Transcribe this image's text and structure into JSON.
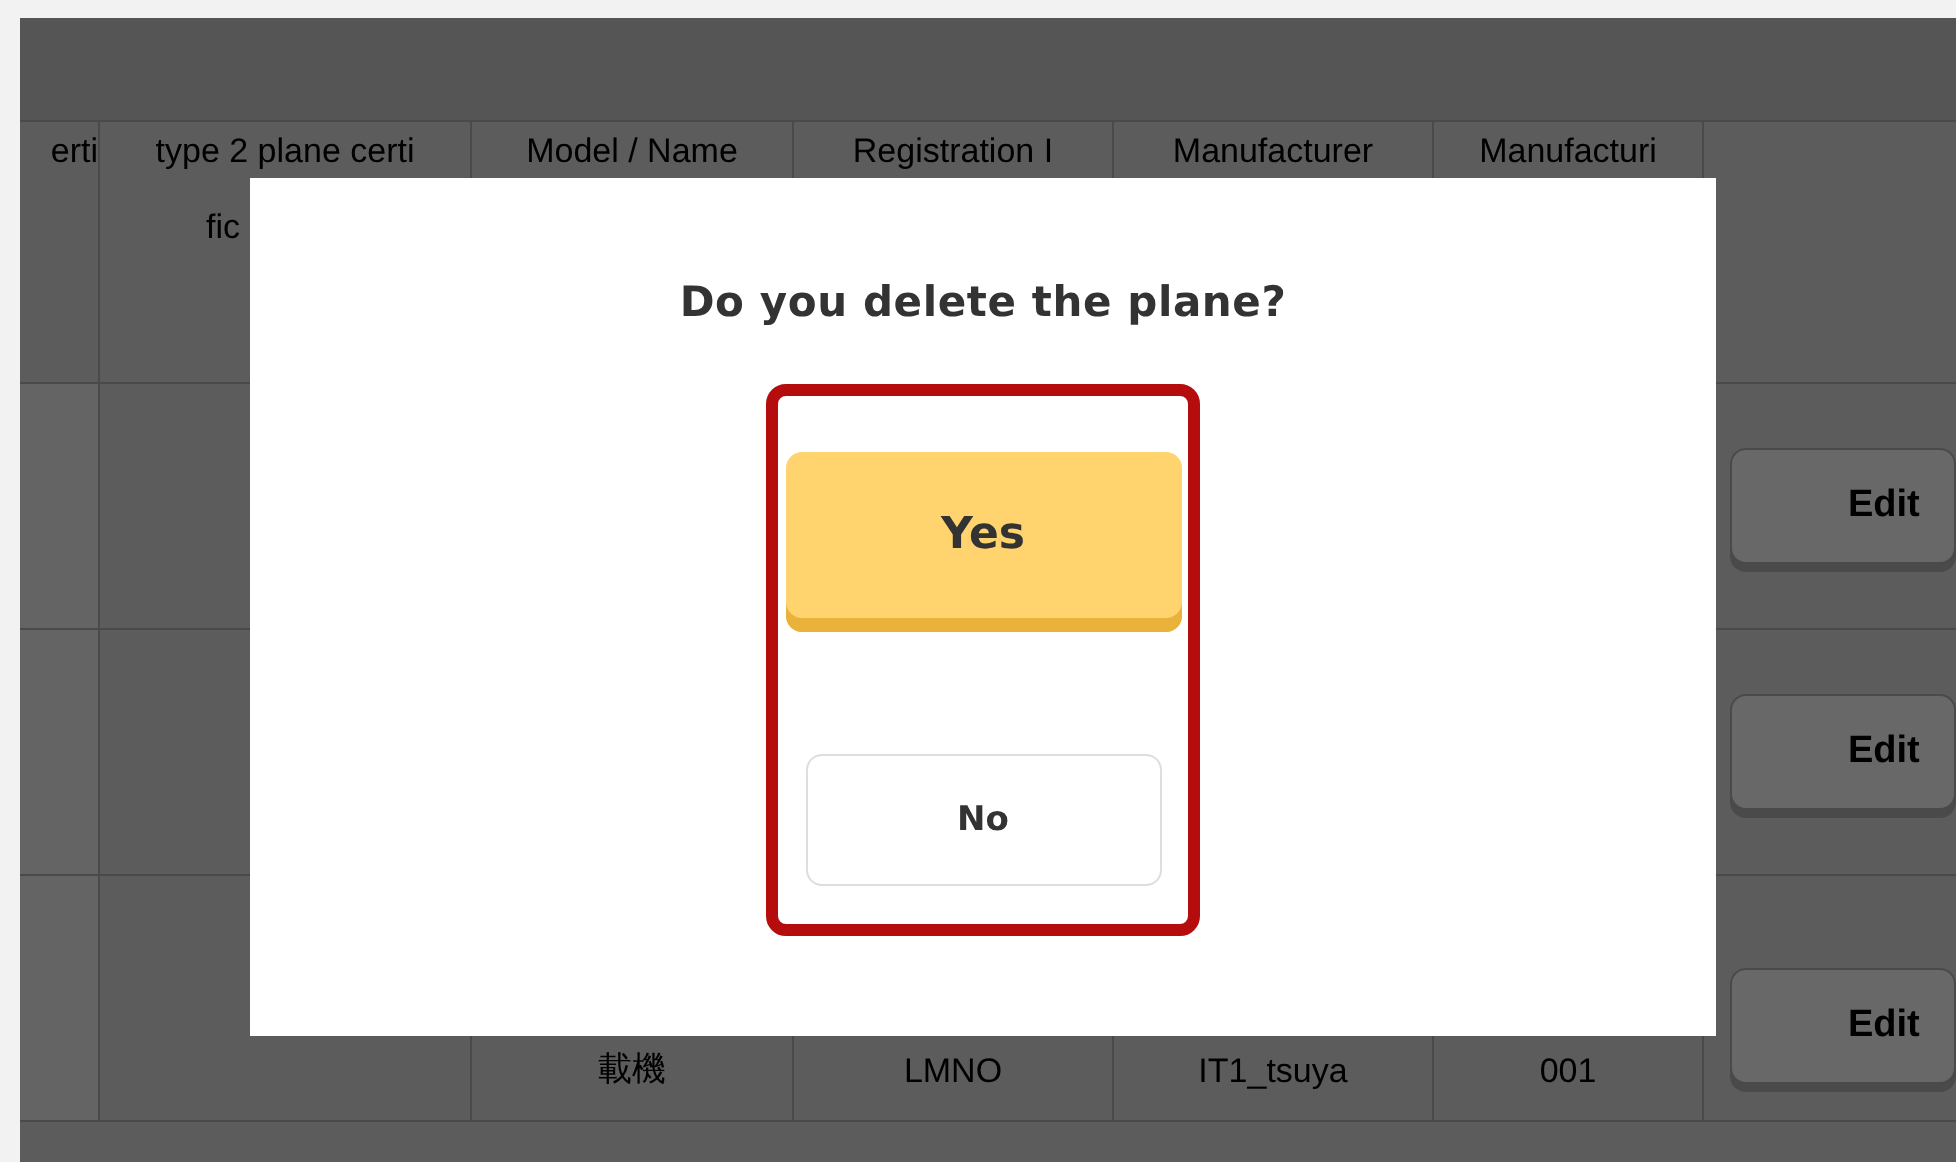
{
  "table": {
    "columns": [
      {
        "label": "erti"
      },
      {
        "label": "type 2 plane certi",
        "continuation": "fic"
      },
      {
        "label": "Model / Name"
      },
      {
        "label": "Registration I"
      },
      {
        "label": "Manufacturer"
      },
      {
        "label": "Manufacturi"
      }
    ],
    "rows": [
      {
        "action": "Edit"
      },
      {
        "action": "Edit"
      },
      {
        "cells": [
          null,
          null,
          "載機",
          "LMNO",
          "IT1_tsuya",
          "001"
        ],
        "action": "Edit"
      }
    ]
  },
  "dialog": {
    "title": "Do you delete the plane?",
    "highlighted": true,
    "buttons": [
      {
        "label": "Yes",
        "kind": "primary"
      },
      {
        "label": "No",
        "kind": "secondary"
      }
    ]
  }
}
